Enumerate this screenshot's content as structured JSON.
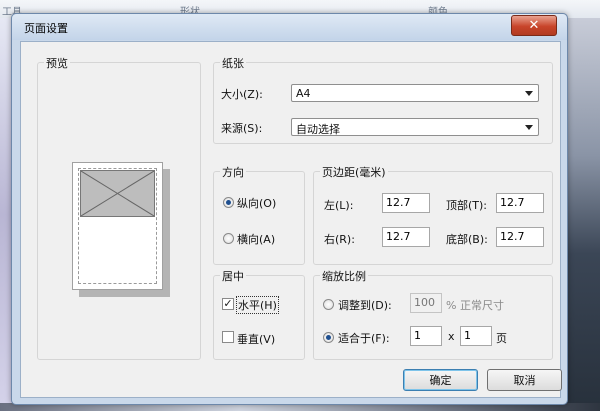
{
  "background": {
    "menu_items": [
      "工具",
      "形状",
      "颜色"
    ]
  },
  "dialog": {
    "title": "页面设置",
    "close_icon": "close-icon"
  },
  "preview": {
    "legend": "预览"
  },
  "paper": {
    "legend": "纸张",
    "size_label": "大小(Z):",
    "size_value": "A4",
    "source_label": "来源(S):",
    "source_value": "自动选择"
  },
  "orientation": {
    "legend": "方向",
    "portrait": "纵向(O)",
    "landscape": "横向(A)",
    "selected": "portrait"
  },
  "margins": {
    "legend": "页边距(毫米)",
    "left_label": "左(L):",
    "left_value": "12.7",
    "top_label": "顶部(T):",
    "top_value": "12.7",
    "right_label": "右(R):",
    "right_value": "12.7",
    "bottom_label": "底部(B):",
    "bottom_value": "12.7"
  },
  "center": {
    "legend": "居中",
    "horizontal": "水平(H)",
    "horizontal_checked": true,
    "vertical": "垂直(V)",
    "vertical_checked": false
  },
  "scaling": {
    "legend": "缩放比例",
    "adjust_label": "调整到(D):",
    "adjust_value": "100",
    "adjust_suffix": "% 正常尺寸",
    "fit_label": "适合于(F):",
    "fit_wide": "1",
    "fit_x": "x",
    "fit_tall": "1",
    "fit_unit": "页",
    "selected": "fit"
  },
  "buttons": {
    "ok": "确定",
    "cancel": "取消"
  },
  "colors": {
    "dialog_frame": "#c9d8ea",
    "close": "#c8442a",
    "face": "#f0f0f0"
  }
}
